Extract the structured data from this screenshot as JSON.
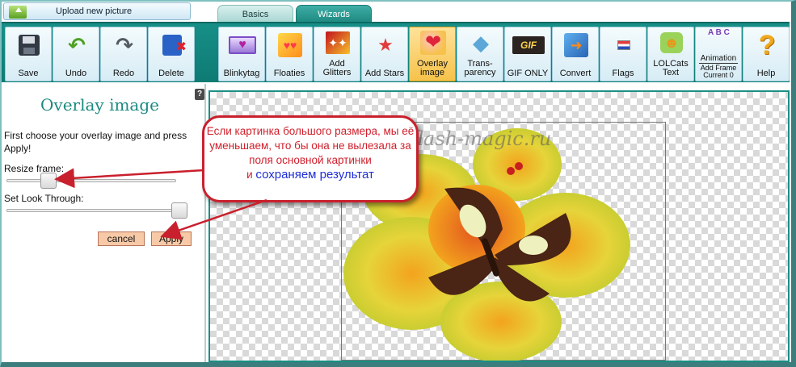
{
  "top": {
    "upload_label": "Upload new picture",
    "tabs": [
      {
        "label": "Basics",
        "active": false
      },
      {
        "label": "Wizards",
        "active": true
      }
    ]
  },
  "toolbar": {
    "left": [
      {
        "id": "save",
        "label": "Save",
        "icon": "floppy-disk-icon"
      },
      {
        "id": "undo",
        "label": "Undo",
        "icon": "undo-arrow-icon"
      },
      {
        "id": "redo",
        "label": "Redo",
        "icon": "redo-arrow-icon"
      },
      {
        "id": "delete",
        "label": "Delete",
        "icon": "delete-icon"
      }
    ],
    "right": [
      {
        "id": "blinkytag",
        "label": "Blinkytag",
        "icon": "blinkytag-icon"
      },
      {
        "id": "floaties",
        "label": "Floaties",
        "icon": "floaties-icon"
      },
      {
        "id": "add-glitters",
        "label": "Add Glitters",
        "icon": "glitter-icon"
      },
      {
        "id": "add-stars",
        "label": "Add Stars",
        "icon": "stars-wand-icon"
      },
      {
        "id": "overlay-image",
        "label": "Overlay image",
        "icon": "overlay-heart-icon",
        "active": true
      },
      {
        "id": "transparency",
        "label": "Trans-parency",
        "icon": "diamond-icon"
      },
      {
        "id": "gif-only",
        "label": "GIF ONLY",
        "icon": "gif-icon"
      },
      {
        "id": "convert",
        "label": "Convert",
        "icon": "convert-icon"
      },
      {
        "id": "flags",
        "label": "Flags",
        "icon": "flag-icon"
      },
      {
        "id": "lolcats",
        "label": "LOLCats Text",
        "icon": "lolcat-icon"
      },
      {
        "id": "animation",
        "label": "Animation",
        "sub1": "Add Frame",
        "sub2": "Current 0",
        "icon": "abc-blocks-icon"
      },
      {
        "id": "help",
        "label": "Help",
        "icon": "question-mark-icon"
      }
    ],
    "glyphs": {
      "undo": "↶",
      "redo": "↷",
      "blinkytag": "♥",
      "floaties": "♥♥",
      "glitters": "✦✦",
      "stars": "★",
      "overlay": "❤",
      "diamond": "◆",
      "gif": "GIF",
      "convert": "➜",
      "lolcat": "☻",
      "abc": "A B C",
      "help": "?"
    }
  },
  "panel": {
    "help_glyph": "?",
    "title": "Overlay image",
    "instructions": "First choose your overlay image and press Apply!",
    "resize_label": "Resize frame:",
    "look_label": "Set Look Through:",
    "cancel_label": "cancel",
    "apply_label": "Apply"
  },
  "canvas": {
    "watermark": "flash-magic.ru"
  },
  "callout": {
    "line1": "Если картинка большого размера, мы её уменьшаем, что бы она не вылезала за поля основной картинки",
    "line2_prefix": "и ",
    "line2_highlight": "сохраняем результат"
  },
  "colors": {
    "accent": "#168f87",
    "active_tool": "#f6c24a",
    "callout_border": "#c9202d",
    "callout_text": "#d0202c",
    "callout_highlight": "#1f2fd8"
  }
}
